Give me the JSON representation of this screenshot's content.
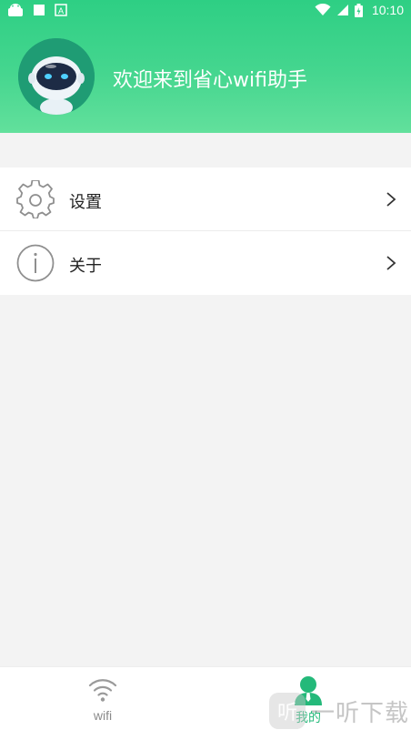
{
  "status_bar": {
    "time": "10:10",
    "icons": [
      "android-icon",
      "square-icon",
      "a-icon",
      "wifi-icon",
      "signal-icon",
      "battery-icon"
    ]
  },
  "header": {
    "welcome_text": "欢迎来到省心wifi助手",
    "gradient_top": "#2ecf84",
    "gradient_bottom": "#62e09c"
  },
  "menu": {
    "items": [
      {
        "label": "设置",
        "icon": "gear-icon"
      },
      {
        "label": "关于",
        "icon": "info-icon"
      }
    ]
  },
  "tabbar": {
    "tabs": [
      {
        "label": "wifi",
        "icon": "wifi-icon",
        "active": false
      },
      {
        "label": "我的",
        "icon": "user-icon",
        "active": true
      }
    ],
    "active_color": "#24b97a"
  },
  "watermark": {
    "logo_glyph": "听",
    "text": "一听下载"
  }
}
